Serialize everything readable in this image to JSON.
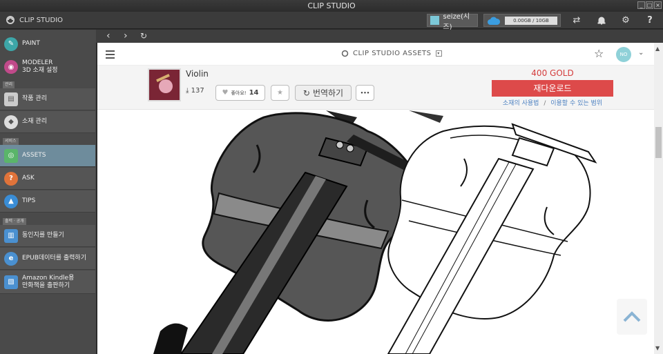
{
  "window": {
    "title": "CLIP STUDIO"
  },
  "appbar": {
    "brand": "CLIP STUDIO",
    "user": "seize(시즈)",
    "storage": "0.00GB / 10GB"
  },
  "sidebar": {
    "paint": "PAINT",
    "modeler": "MODELER",
    "modeler_sub": "3D 소재 설정",
    "section_manage": "관리",
    "works": "작품 관리",
    "materials": "소재 관리",
    "section_service": "서비스",
    "assets": "ASSETS",
    "ask": "ASK",
    "tips": "TIPS",
    "section_publish": "출력 · 공개",
    "doujin": "동인지를 만들기",
    "epub": "EPUB데이터를 출력하기",
    "kindle_1": "Amazon  Kindle용",
    "kindle_2": "만화책을 출판하기"
  },
  "assets": {
    "title": "CLIP STUDIO ASSETS",
    "avatar": "NO",
    "product": {
      "name": "Violin",
      "downloads": "137",
      "like_label": "좋아요!",
      "likes": "14",
      "translate": "번역하기",
      "more": "•••",
      "price": "400 GOLD",
      "download_button": "재다운로드",
      "link_usage": "소재의 사용법",
      "link_sep": "/",
      "link_scope": "이용할 수 있는 범위"
    }
  }
}
